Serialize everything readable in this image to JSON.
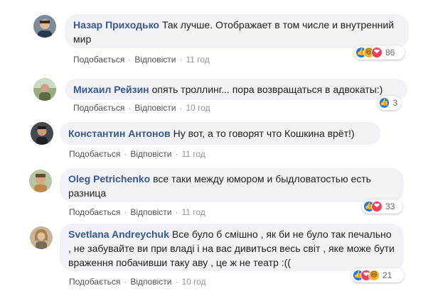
{
  "actions": {
    "like": "Подобається",
    "reply": "Відповісти",
    "separator": "·"
  },
  "comments": [
    {
      "author": "Назар Приходько",
      "text": "Так лучше. Отображает в том числе и внутренний мир",
      "time": "11 год",
      "reactions": [
        "like-icon",
        "haha-icon",
        "love-icon"
      ],
      "count": "86"
    },
    {
      "author": "Михаил Рейзин",
      "text": "опять троллинг... пора возвращаться в адвокаты:)",
      "time": "10 год",
      "reactions": [
        "like-icon"
      ],
      "count": "3"
    },
    {
      "author": "Константин Антонов",
      "text": "Ну вот, а то говорят что Кошкина врёт!)",
      "time": "11 год",
      "reactions": [],
      "count": ""
    },
    {
      "author": "Oleg Petrichenko",
      "text": "все таки между юмором и быдловатостью есть разница",
      "time": "11 год",
      "reactions": [
        "like-icon",
        "love-icon"
      ],
      "count": "33"
    },
    {
      "author": "Svetlana Andreychuk",
      "text": "Все було б смішно , як би не було так печально , не забувайте ви при владі і на вас дивиться весь світ , яке може бути враження побачивши таку аву , це ж не театр :((",
      "time": "10 год",
      "reactions": [
        "like-icon",
        "love-icon",
        "haha-icon"
      ],
      "count": "21"
    }
  ],
  "colors": {
    "author": "#385898",
    "bubble": "#f0f2f5",
    "meta": "#90949c",
    "like_reaction": "#1877f2",
    "love_reaction": "#f33e58",
    "haha_reaction": "#f7b125"
  }
}
